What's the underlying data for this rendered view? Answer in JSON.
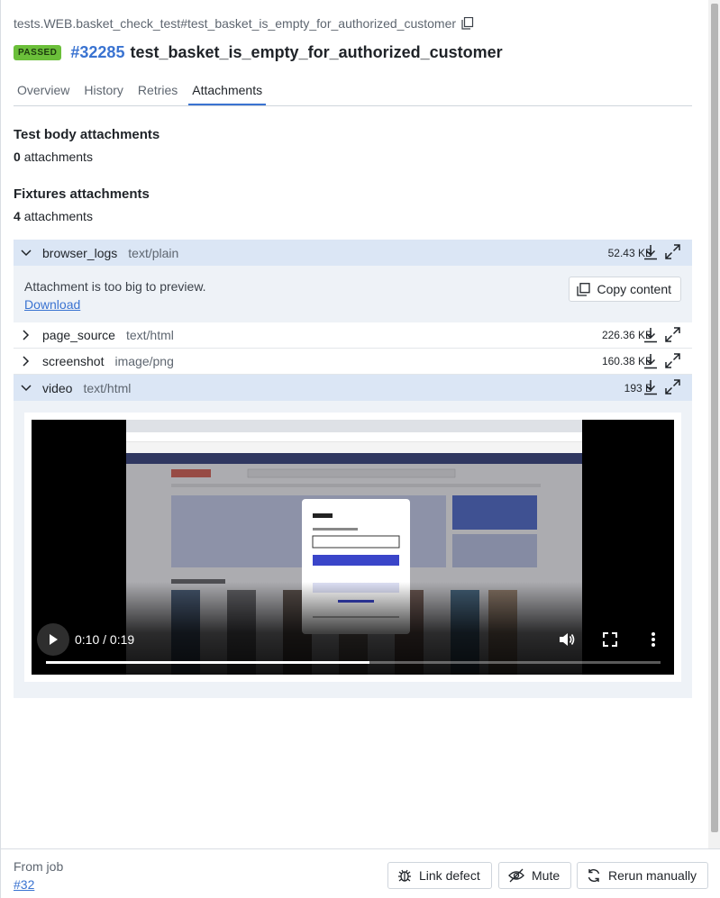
{
  "header": {
    "path": "tests.WEB.basket_check_test#test_basket_is_empty_for_authorized_customer",
    "status_badge": "PASSED",
    "test_id": "#32285",
    "test_name": "test_basket_is_empty_for_authorized_customer"
  },
  "tabs": [
    {
      "label": "Overview",
      "active": false
    },
    {
      "label": "History",
      "active": false
    },
    {
      "label": "Retries",
      "active": false
    },
    {
      "label": "Attachments",
      "active": true
    }
  ],
  "test_body": {
    "title": "Test body attachments",
    "count": "0",
    "count_label": "attachments"
  },
  "fixtures": {
    "title": "Fixtures attachments",
    "count": "4",
    "count_label": "attachments"
  },
  "attachments": [
    {
      "name": "browser_logs",
      "type": "text/plain",
      "size": "52.43 KB",
      "expanded": true
    },
    {
      "name": "page_source",
      "type": "text/html",
      "size": "226.36 KB",
      "expanded": false
    },
    {
      "name": "screenshot",
      "type": "image/png",
      "size": "160.38 KB",
      "expanded": false
    },
    {
      "name": "video",
      "type": "text/html",
      "size": "193 B",
      "expanded": true
    }
  ],
  "preview": {
    "message": "Attachment is too big to preview.",
    "download_label": "Download",
    "copy_label": "Copy content"
  },
  "video_player": {
    "time": "0:10 / 0:19",
    "progress_fraction": 0.526
  },
  "footer": {
    "from_job_label": "From job",
    "job_link": "#32",
    "link_defect_label": "Link defect",
    "mute_label": "Mute",
    "rerun_label": "Rerun manually"
  },
  "colors": {
    "accent": "#3a73d1",
    "passed": "#6bbf3a",
    "expanded_row": "#dbe6f5"
  }
}
